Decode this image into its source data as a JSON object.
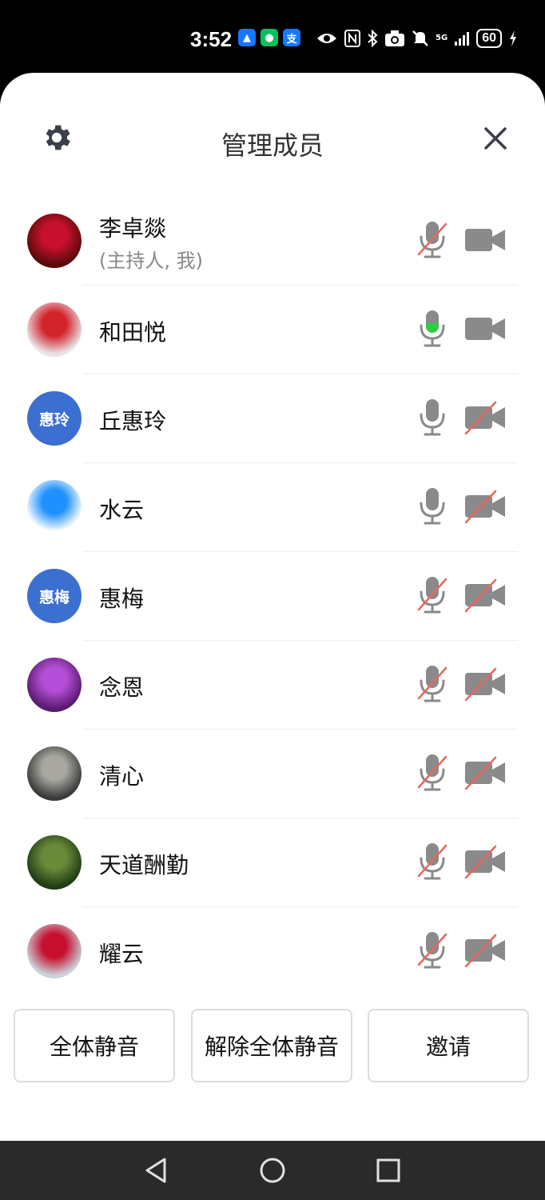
{
  "status_bar": {
    "time": "3:52",
    "app_icons": [
      {
        "name": "maps-app-icon",
        "glyph": "▲",
        "color": "#1677ff"
      },
      {
        "name": "wechat-app-icon",
        "glyph": "●",
        "color": "#07c160"
      },
      {
        "name": "alipay-app-icon",
        "glyph": "支",
        "color": "#1677ff"
      }
    ],
    "network": "5G",
    "battery": "60"
  },
  "header": {
    "title": "管理成员"
  },
  "members": [
    {
      "name": "李卓燚",
      "subtitle": "(主持人, 我)",
      "avatar_type": "image",
      "avatar_colors": [
        "#5a0a0a",
        "#c8102e"
      ],
      "mic": "muted",
      "camera": "off-idle"
    },
    {
      "name": "和田悦",
      "subtitle": "",
      "avatar_type": "image",
      "avatar_colors": [
        "#e8e4e8",
        "#d2232a"
      ],
      "mic": "active",
      "camera": "available"
    },
    {
      "name": "丘惠玲",
      "subtitle": "",
      "avatar_type": "text",
      "avatar_text": "惠玲",
      "avatar_colors": [
        "#3b6fd0",
        "#3b6fd0"
      ],
      "mic": "available",
      "camera": "off"
    },
    {
      "name": "水云",
      "subtitle": "",
      "avatar_type": "image",
      "avatar_colors": [
        "#ffffff",
        "#1e90ff"
      ],
      "mic": "available",
      "camera": "off"
    },
    {
      "name": "惠梅",
      "subtitle": "",
      "avatar_type": "text",
      "avatar_text": "惠梅",
      "avatar_colors": [
        "#3b6fd0",
        "#3b6fd0"
      ],
      "mic": "muted",
      "camera": "off"
    },
    {
      "name": "念恩",
      "subtitle": "",
      "avatar_type": "image",
      "avatar_colors": [
        "#5a1a6e",
        "#b34fd6"
      ],
      "mic": "muted",
      "camera": "off"
    },
    {
      "name": "清心",
      "subtitle": "",
      "avatar_type": "image",
      "avatar_colors": [
        "#3a3a3a",
        "#a8a8a0"
      ],
      "mic": "muted",
      "camera": "off"
    },
    {
      "name": "天道酬勤",
      "subtitle": "",
      "avatar_type": "image",
      "avatar_colors": [
        "#1f3d14",
        "#6a8a3a"
      ],
      "mic": "muted",
      "camera": "off"
    },
    {
      "name": "耀云",
      "subtitle": "",
      "avatar_type": "image",
      "avatar_colors": [
        "#c9d3dc",
        "#c8102e"
      ],
      "mic": "muted",
      "camera": "off"
    }
  ],
  "buttons": {
    "mute_all": "全体静音",
    "unmute_all": "解除全体静音",
    "invite": "邀请"
  },
  "colors": {
    "icon_gray": "#8a8a8a",
    "mute_slash": "#e8675a",
    "mic_active": "#2ecc40",
    "avatar_blue": "#3b6fd0"
  }
}
